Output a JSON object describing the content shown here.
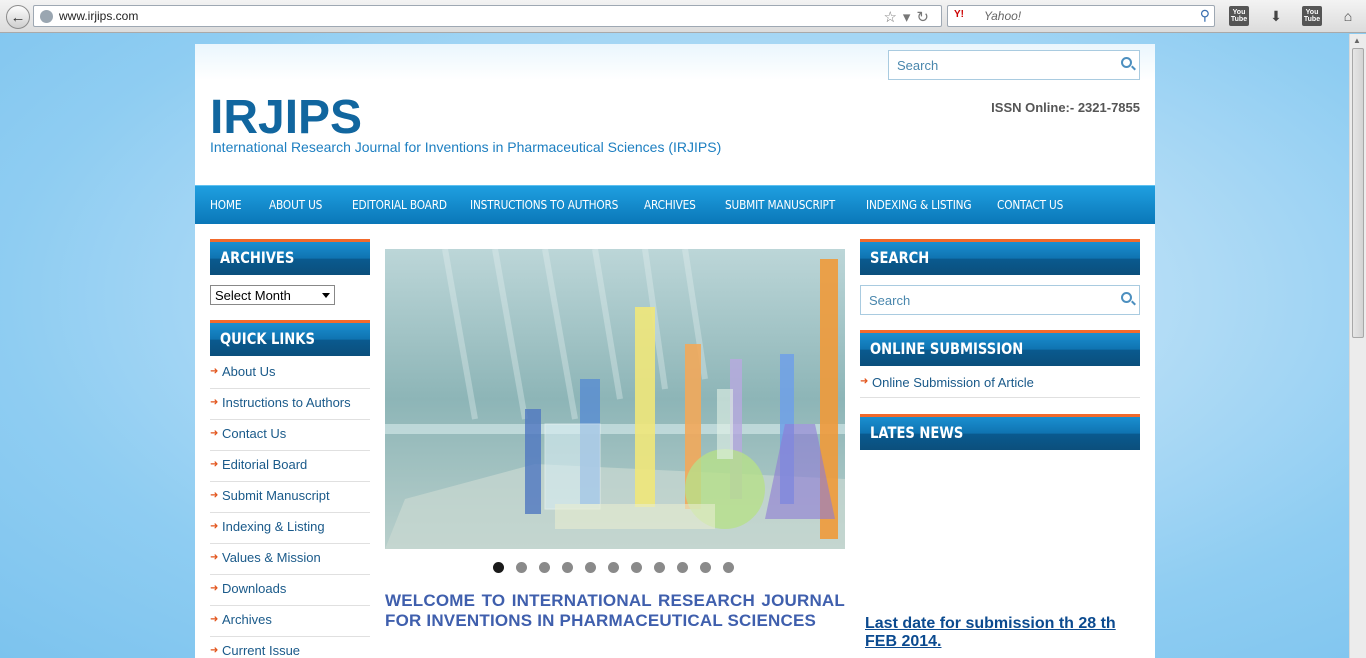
{
  "browser": {
    "url": "www.irjips.com",
    "search_placeholder": "Yahoo!",
    "search_engine_icon": "Y!"
  },
  "site": {
    "top_search_placeholder": "Search",
    "logo": "IRJIPS",
    "tagline": "International Research Journal for Inventions in Pharmaceutical Sciences (IRJIPS)",
    "issn": "ISSN Online:- 2321-7855"
  },
  "nav": [
    "HOME",
    "ABOUT US",
    "EDITORIAL BOARD",
    "INSTRUCTIONS TO AUTHORS",
    "ARCHIVES",
    "SUBMIT MANUSCRIPT",
    "INDEXING & LISTING",
    "CONTACT US"
  ],
  "left": {
    "archives_title": "ARCHIVES",
    "archives_select": "Select Month",
    "quick_links_title": "QUICK LINKS",
    "quick_links": [
      "About Us",
      "Instructions to Authors",
      "Contact Us",
      "Editorial Board",
      "Submit Manuscript",
      "Indexing & Listing",
      "Values & Mission",
      "Downloads",
      "Archives",
      "Current Issue"
    ]
  },
  "main": {
    "slider_active_dot": 1,
    "slider_dot_count": 11,
    "welcome": "WELCOME TO INTERNATIONAL RESEARCH JOURNAL FOR INVENTIONS IN PHARMACEUTICAL SCIENCES"
  },
  "right": {
    "search_title": "SEARCH",
    "search_placeholder": "Search",
    "online_submission_title": "ONLINE SUBMISSION",
    "online_submission_link": "Online Submission of Article",
    "news_title": "LATES NEWS",
    "news_item": "Last date for submission th 28 th FEB 2014."
  },
  "colors": {
    "nav_blue": "#0f83c6",
    "accent_orange": "#f26a2c",
    "logo_blue": "#11669f",
    "welcome_blue": "#3f5fad"
  }
}
